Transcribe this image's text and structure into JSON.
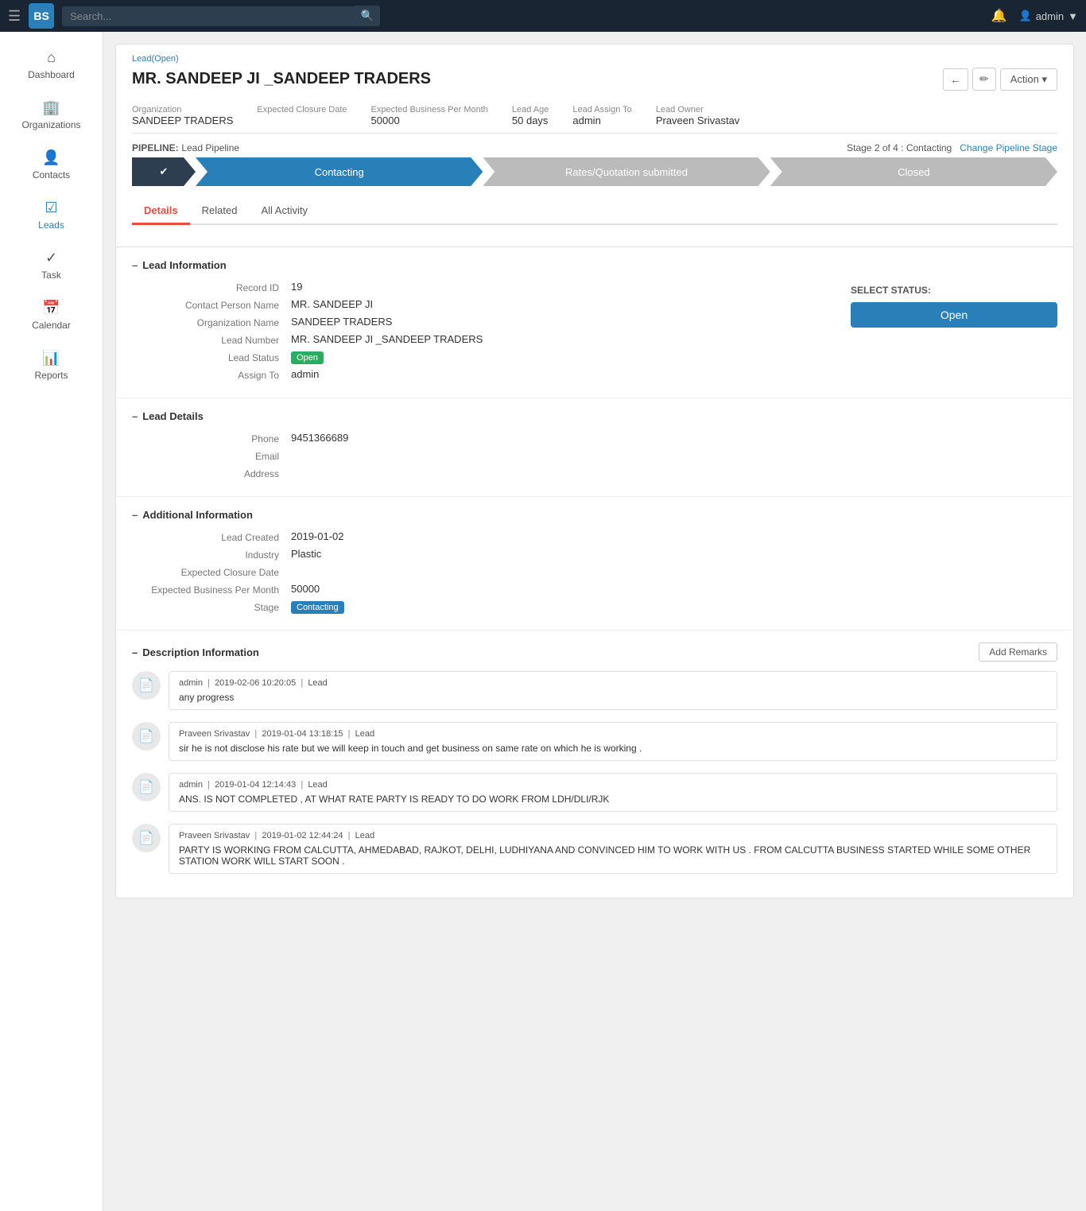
{
  "topnav": {
    "logo": "BS",
    "search_placeholder": "Search...",
    "bell_icon": "🔔",
    "user_icon": "👤",
    "username": "admin",
    "chevron": "▼"
  },
  "sidebar": {
    "items": [
      {
        "id": "dashboard",
        "icon": "⌂",
        "label": "Dashboard"
      },
      {
        "id": "organizations",
        "icon": "🏢",
        "label": "Organizations"
      },
      {
        "id": "contacts",
        "icon": "👤",
        "label": "Contacts"
      },
      {
        "id": "leads",
        "icon": "☑",
        "label": "Leads",
        "active": true
      },
      {
        "id": "task",
        "icon": "✓",
        "label": "Task"
      },
      {
        "id": "calendar",
        "icon": "📅",
        "label": "Calendar"
      },
      {
        "id": "reports",
        "icon": "📊",
        "label": "Reports"
      }
    ]
  },
  "breadcrumb": "Lead(Open)",
  "page": {
    "title": "MR. SANDEEP JI _SANDEEP TRADERS",
    "prev_icon": "←",
    "edit_icon": "✏",
    "action_label": "Action ▾"
  },
  "meta": {
    "organization_label": "Organization",
    "organization_value": "SANDEEP TRADERS",
    "expected_closure_label": "Expected Closure Date",
    "expected_closure_value": "",
    "expected_business_label": "Expected Business Per Month",
    "expected_business_value": "50000",
    "lead_age_label": "Lead Age",
    "lead_age_value": "50 days",
    "lead_assign_label": "Lead Assign To",
    "lead_assign_value": "admin",
    "lead_owner_label": "Lead Owner",
    "lead_owner_value": "Praveen Srivastav"
  },
  "pipeline": {
    "label": "PIPELINE:",
    "name": "Lead Pipeline",
    "stage_info": "Stage 2 of 4 : Contacting",
    "change_label": "Change Pipeline Stage",
    "steps": [
      {
        "label": "✔",
        "state": "done"
      },
      {
        "label": "Contacting",
        "state": "active"
      },
      {
        "label": "Rates/Quotation submitted",
        "state": "inactive"
      },
      {
        "label": "Closed",
        "state": "inactive"
      }
    ]
  },
  "tabs": [
    {
      "id": "details",
      "label": "Details",
      "active": true
    },
    {
      "id": "related",
      "label": "Related"
    },
    {
      "id": "all_activity",
      "label": "All Activity"
    }
  ],
  "lead_information": {
    "section_title": "Lead Information",
    "record_id_label": "Record ID",
    "record_id_value": "19",
    "contact_person_label": "Contact Person Name",
    "contact_person_value": "MR. SANDEEP JI",
    "organization_label": "Organization Name",
    "organization_value": "SANDEEP TRADERS",
    "lead_number_label": "Lead Number",
    "lead_number_value": "MR. SANDEEP JI _SANDEEP TRADERS",
    "lead_status_label": "Lead Status",
    "lead_status_value": "Open",
    "assign_to_label": "Assign To",
    "assign_to_value": "admin",
    "select_status_label": "SELECT STATUS:",
    "open_button_label": "Open"
  },
  "lead_details": {
    "section_title": "Lead Details",
    "phone_label": "Phone",
    "phone_value": "9451366689",
    "email_label": "Email",
    "email_value": "",
    "address_label": "Address",
    "address_value": ""
  },
  "additional_information": {
    "section_title": "Additional Information",
    "lead_created_label": "Lead Created",
    "lead_created_value": "2019-01-02",
    "industry_label": "Industry",
    "industry_value": "Plastic",
    "expected_closure_label": "Expected Closure Date",
    "expected_closure_value": "",
    "expected_business_label": "Expected Business Per Month",
    "expected_business_value": "50000",
    "stage_label": "Stage",
    "stage_value": "Contacting"
  },
  "description": {
    "section_title": "Description Information",
    "add_remarks_label": "Add Remarks",
    "remarks": [
      {
        "icon": "📄",
        "author": "admin",
        "date": "2019-02-06 10:20:05",
        "type": "Lead",
        "text": "any progress"
      },
      {
        "icon": "📄",
        "author": "Praveen Srivastav",
        "date": "2019-01-04 13:18:15",
        "type": "Lead",
        "text": "sir he is not disclose his rate but we will keep in touch and get business on same rate on which he is working ."
      },
      {
        "icon": "📄",
        "author": "admin",
        "date": "2019-01-04 12:14:43",
        "type": "Lead",
        "text": "ANS. IS NOT COMPLETED , AT WHAT RATE PARTY IS READY TO DO WORK FROM LDH/DLI/RJK"
      },
      {
        "icon": "📄",
        "author": "Praveen Srivastav",
        "date": "2019-01-02 12:44:24",
        "type": "Lead",
        "text": "PARTY IS WORKING FROM CALCUTTA, AHMEDABAD, RAJKOT, DELHI, LUDHIYANA AND CONVINCED HIM TO WORK WITH US . FROM CALCUTTA BUSINESS STARTED WHILE SOME OTHER STATION WORK WILL START SOON ."
      }
    ]
  }
}
